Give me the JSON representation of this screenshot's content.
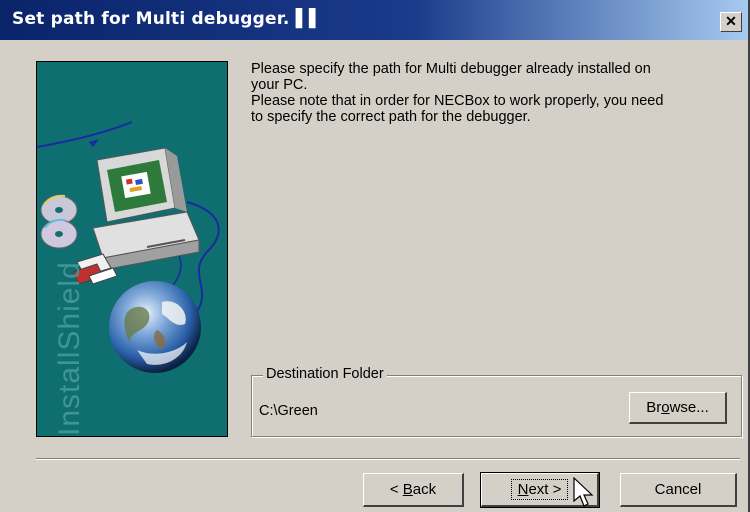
{
  "window": {
    "title": "Set path for Multi debugger.",
    "title_mark": "▌▌",
    "close_glyph": "✕"
  },
  "banner": {
    "brand_text": "InstallShield",
    "colors": {
      "background": "#0f6f70",
      "earth": "#2a5fa8"
    }
  },
  "message": {
    "line1": "Please specify the path for Multi debugger already installed on",
    "line2": "your PC.",
    "line3": "Please note that in order for NECBox to work properly, you need",
    "line4": "to specify the correct path for the debugger."
  },
  "destination": {
    "group_label": "Destination Folder",
    "path": "C:\\Green",
    "browse_prefix": "Br",
    "browse_accel": "o",
    "browse_suffix": "wse..."
  },
  "buttons": {
    "back_prefix": "< ",
    "back_accel": "B",
    "back_suffix": "ack",
    "next_accel": "N",
    "next_suffix": "ext >",
    "cancel": "Cancel"
  },
  "colors": {
    "titlebar_start": "#0a246a",
    "titlebar_end": "#a6caf0",
    "face": "#d4d0c8"
  }
}
